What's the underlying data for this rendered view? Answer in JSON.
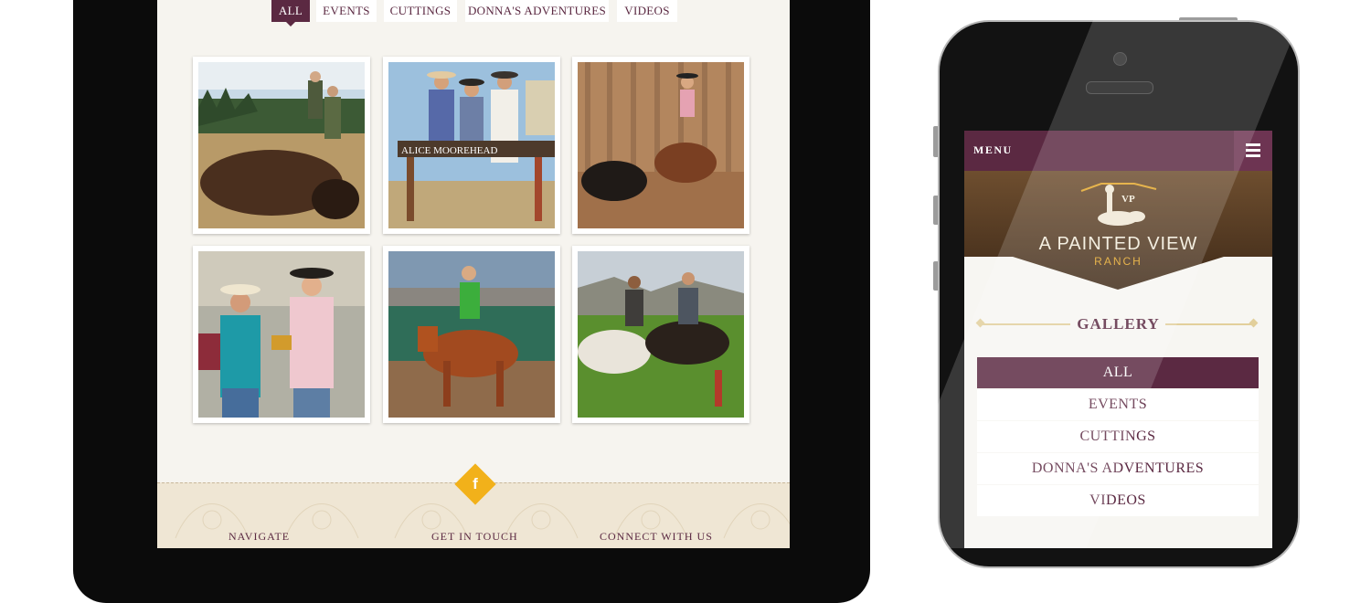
{
  "tablet": {
    "filters": [
      {
        "label": "ALL",
        "active": true
      },
      {
        "label": "EVENTS",
        "active": false
      },
      {
        "label": "CUTTINGS",
        "active": false
      },
      {
        "label": "DONNA'S ADVENTURES",
        "active": false
      },
      {
        "label": "VIDEOS",
        "active": false
      }
    ],
    "photos": [
      {
        "subject": "bison-hunt-photo"
      },
      {
        "subject": "alice-moorehead-sign-photo"
      },
      {
        "subject": "cutting-horse-photo"
      },
      {
        "subject": "award-handshake-photo"
      },
      {
        "subject": "rider-chestnut-horse-photo"
      },
      {
        "subject": "horses-polo-field-photo"
      }
    ],
    "photo_sign_text": "ALICE MOOREHEAD",
    "footer": {
      "social_icon": "facebook-icon",
      "social_letter": "f",
      "columns": [
        "NAVIGATE",
        "GET IN TOUCH",
        "CONNECT WITH US"
      ]
    }
  },
  "phone": {
    "menu_label": "MENU",
    "menu_icon": "hamburger-icon",
    "brand": {
      "name": "A PAINTED VIEW",
      "sub": "RANCH",
      "logo_text": "VP"
    },
    "gallery_title": "GALLERY",
    "filters": [
      {
        "label": "ALL",
        "active": true
      },
      {
        "label": "EVENTS",
        "active": false
      },
      {
        "label": "CUTTINGS",
        "active": false
      },
      {
        "label": "DONNA'S ADVENTURES",
        "active": false
      },
      {
        "label": "VIDEOS",
        "active": false
      }
    ]
  },
  "colors": {
    "accent": "#5b2942",
    "gold": "#f2b11a",
    "background": "#f6f4ef",
    "footer": "#efe6d4"
  }
}
